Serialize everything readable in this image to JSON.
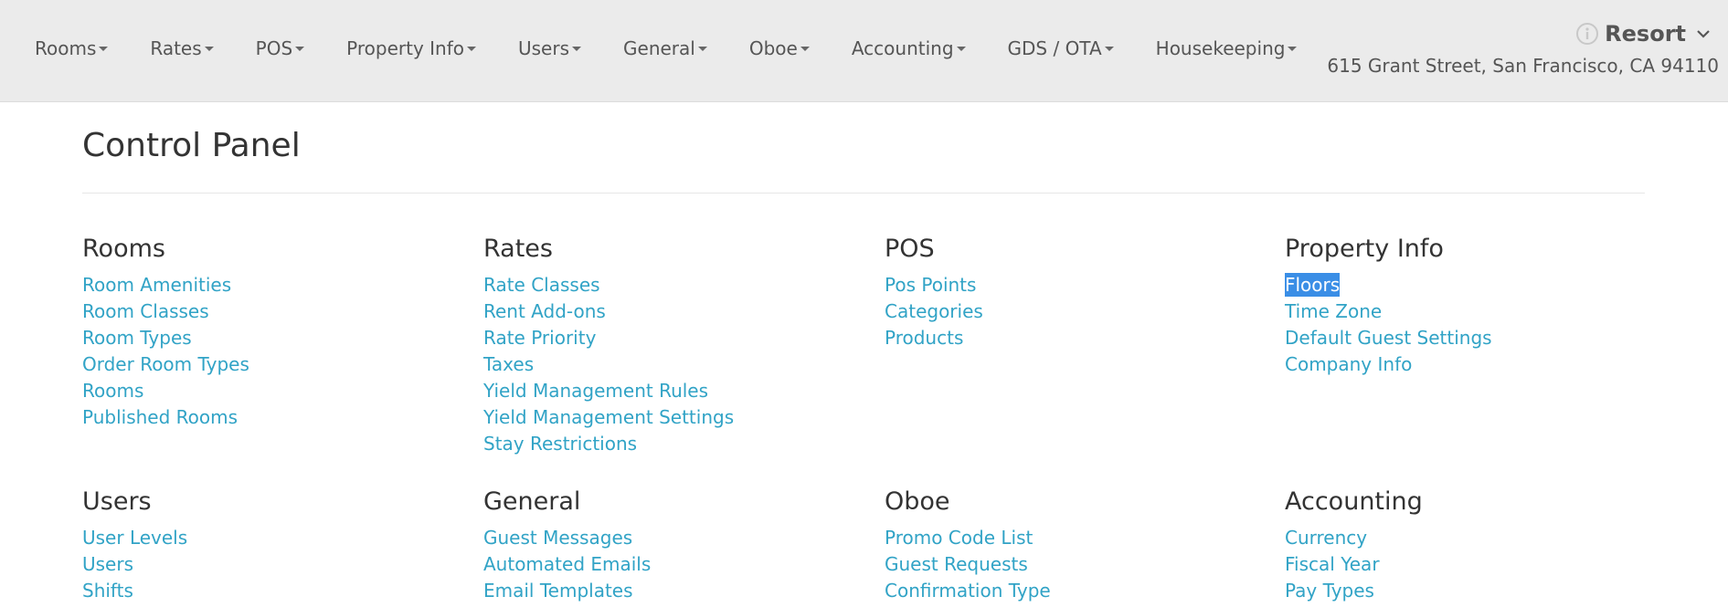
{
  "nav": {
    "items": [
      {
        "label": "Rooms"
      },
      {
        "label": "Rates"
      },
      {
        "label": "POS"
      },
      {
        "label": "Property Info"
      },
      {
        "label": "Users"
      },
      {
        "label": "General"
      },
      {
        "label": "Oboe"
      },
      {
        "label": "Accounting"
      },
      {
        "label": "GDS / OTA"
      },
      {
        "label": "Housekeeping"
      }
    ],
    "resort_name": "Resort",
    "address": "615 Grant Street, San Francisco, CA 94110"
  },
  "page": {
    "title": "Control Panel"
  },
  "sections": [
    {
      "title": "Rooms",
      "links": [
        "Room Amenities",
        "Room Classes",
        "Room Types",
        "Order Room Types",
        "Rooms",
        "Published Rooms"
      ]
    },
    {
      "title": "Rates",
      "links": [
        "Rate Classes",
        "Rent Add-ons",
        "Rate Priority",
        "Taxes",
        "Yield Management Rules",
        "Yield Management Settings",
        "Stay Restrictions"
      ]
    },
    {
      "title": "POS",
      "links": [
        "Pos Points",
        "Categories",
        "Products"
      ]
    },
    {
      "title": "Property Info",
      "links": [
        "Floors",
        "Time Zone",
        "Default Guest Settings",
        "Company Info"
      ],
      "selected_link": "Floors"
    },
    {
      "title": "Users",
      "links": [
        "User Levels",
        "Users",
        "Shifts"
      ]
    },
    {
      "title": "General",
      "links": [
        "Guest Messages",
        "Automated Emails",
        "Email Templates"
      ]
    },
    {
      "title": "Oboe",
      "links": [
        "Promo Code List",
        "Guest Requests",
        "Confirmation Type"
      ]
    },
    {
      "title": "Accounting",
      "links": [
        "Currency",
        "Fiscal Year",
        "Pay Types"
      ]
    }
  ],
  "colors": {
    "link": "#31a3c6",
    "topbar_bg": "#ebebeb",
    "selection_bg": "#3a8ee6"
  },
  "icons": {
    "info": "info-circle-icon",
    "dropdown": "caret-down-icon",
    "resort_menu": "chevron-down-icon"
  }
}
